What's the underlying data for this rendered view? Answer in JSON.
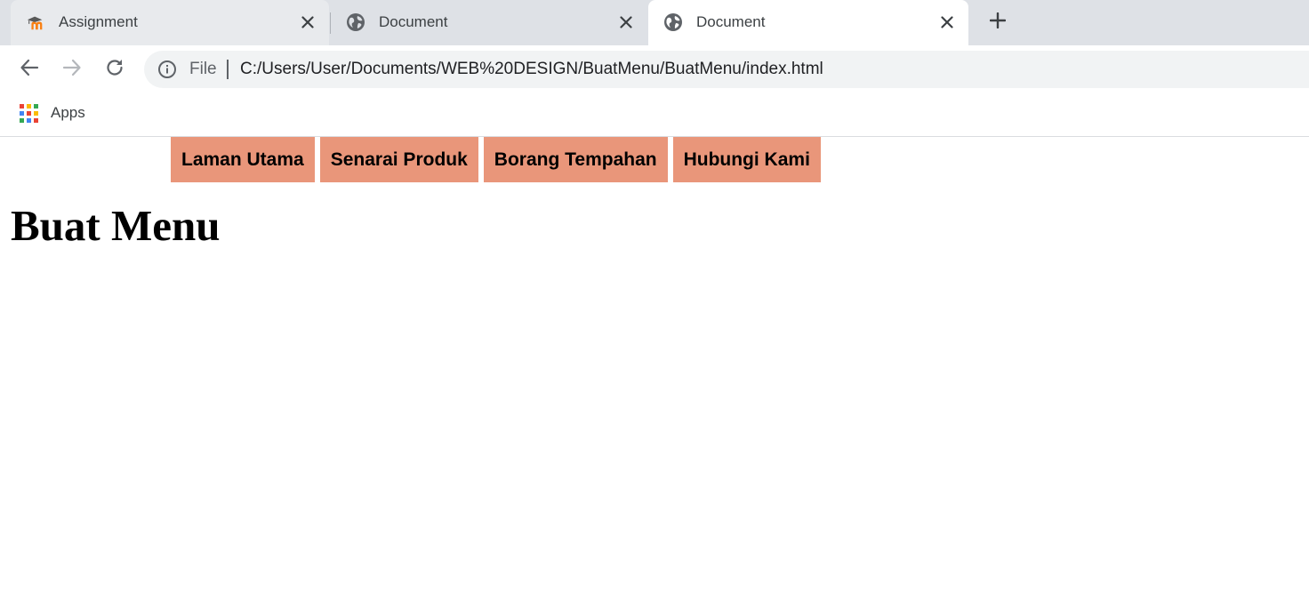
{
  "browser": {
    "tabs": [
      {
        "title": "Assignment",
        "icon": "moodle-icon",
        "active": false
      },
      {
        "title": "Document",
        "icon": "globe-icon",
        "active": false
      },
      {
        "title": "Document",
        "icon": "globe-icon",
        "active": true
      }
    ],
    "address_bar": {
      "scheme_label": "File",
      "url": "C:/Users/User/Documents/WEB%20DESIGN/BuatMenu/BuatMenu/index.html"
    },
    "bookmarks": [
      {
        "label": "Apps",
        "icon": "apps-grid-icon"
      }
    ]
  },
  "page": {
    "menu": [
      {
        "label": "Laman Utama"
      },
      {
        "label": "Senarai Produk"
      },
      {
        "label": "Borang Tempahan"
      },
      {
        "label": "Hubungi Kami"
      }
    ],
    "heading": "Buat Menu"
  },
  "colors": {
    "menu_item_bg": "#e9967a",
    "tabstrip_bg": "#dee1e6",
    "omnibox_bg": "#f1f3f4"
  }
}
